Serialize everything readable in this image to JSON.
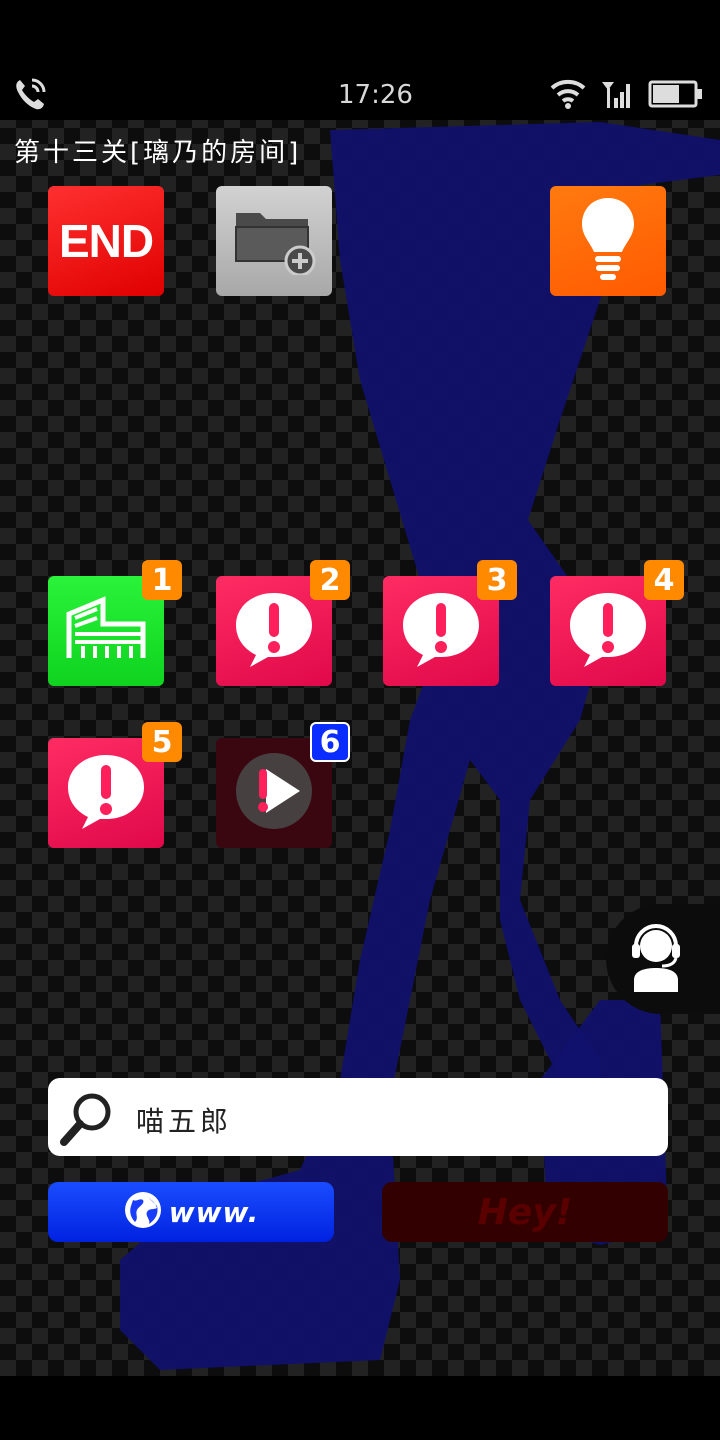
{
  "status_bar": {
    "time": "17:26",
    "left_icon": "phone-signal-icon",
    "right_icons": [
      "wifi-icon",
      "cell-signal-icon",
      "battery-icon"
    ]
  },
  "level_title": "第十三关[璃乃的房间]",
  "toolbar": {
    "end_label": "END",
    "end_color": "#ff1a1a",
    "folder_icon": "folder-add-icon",
    "hint_icon": "lightbulb-icon",
    "hint_color": "#ff6a00"
  },
  "apps": [
    {
      "badge": "1",
      "icon": "building-icon",
      "color": "#11ee22",
      "badge_color": "#ff8a00"
    },
    {
      "badge": "2",
      "icon": "alert-bubble-icon",
      "color": "#ff1f5a",
      "badge_color": "#ff8a00"
    },
    {
      "badge": "3",
      "icon": "alert-bubble-icon",
      "color": "#ff1f5a",
      "badge_color": "#ff8a00"
    },
    {
      "badge": "4",
      "icon": "alert-bubble-icon",
      "color": "#ff1f5a",
      "badge_color": "#ff8a00"
    },
    {
      "badge": "5",
      "icon": "alert-bubble-icon",
      "color": "#ff1f5a",
      "badge_color": "#ff8a00"
    },
    {
      "badge": "6",
      "icon": "play-video-icon",
      "color": "#3a0710",
      "badge_color": "#0a2cff"
    }
  ],
  "search": {
    "icon": "search-icon",
    "value": "喵五郎"
  },
  "buttons": {
    "www_label": "www.",
    "www_color": "#1a3dff",
    "hey_label": "Hey!"
  },
  "support": {
    "icon": "customer-service-icon"
  }
}
